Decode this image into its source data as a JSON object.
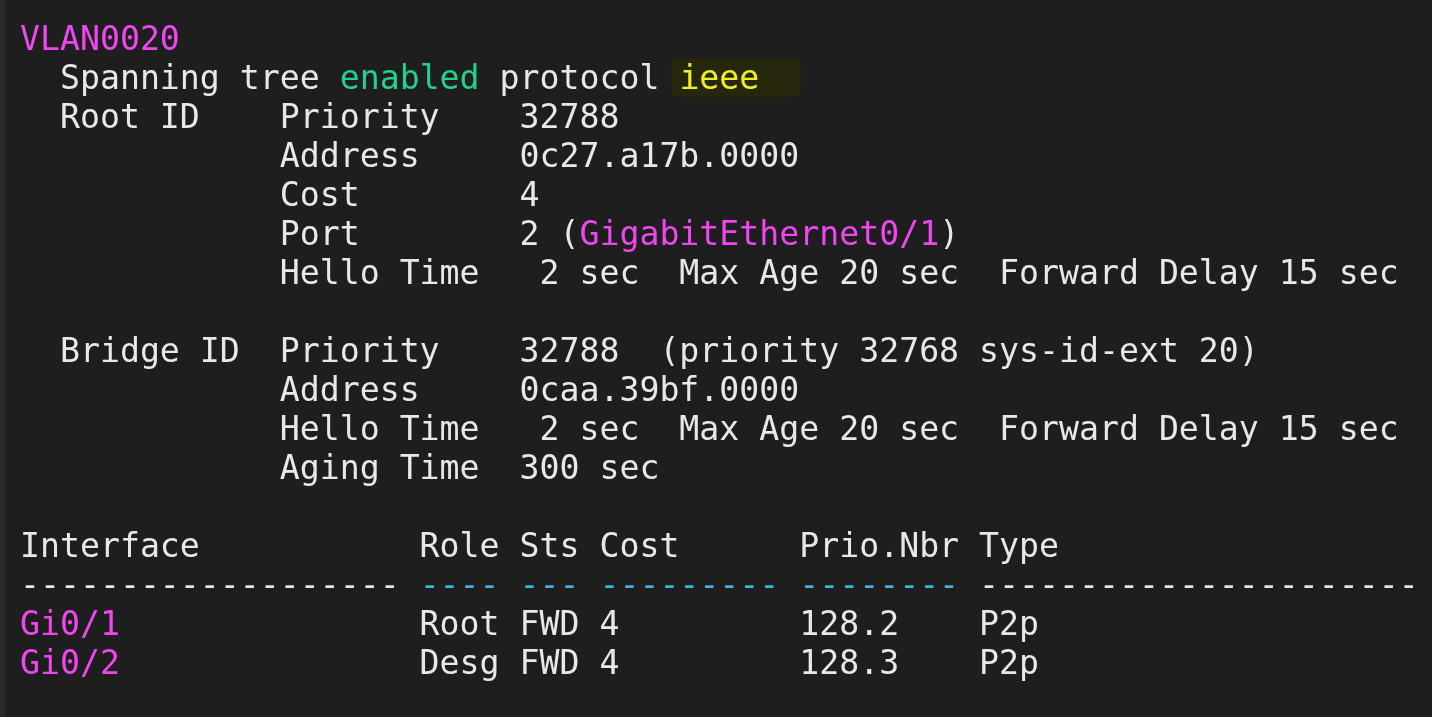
{
  "terminal": {
    "lines": [
      {
        "kind": "text",
        "segments": [
          {
            "text": "VLAN0020",
            "color": "#f046f0"
          }
        ]
      },
      {
        "kind": "text",
        "segments": [
          {
            "text": "  Spanning tree "
          },
          {
            "text": "enabled",
            "color": "#23d18b"
          },
          {
            "text": " protocol "
          },
          {
            "text": "ieee",
            "color": "#f0f020",
            "highlighted": true
          }
        ]
      },
      {
        "kind": "text",
        "segments": [
          {
            "text": "  Root ID    Priority    32788"
          }
        ]
      },
      {
        "kind": "text",
        "segments": [
          {
            "text": "             Address     0c27.a17b.0000"
          }
        ]
      },
      {
        "kind": "text",
        "segments": [
          {
            "text": "             Cost        4"
          }
        ]
      },
      {
        "kind": "text",
        "segments": [
          {
            "text": "             Port        2 ("
          },
          {
            "text": "GigabitEthernet0/1",
            "color": "#f046f0"
          },
          {
            "text": ")"
          }
        ]
      },
      {
        "kind": "text",
        "segments": [
          {
            "text": "             Hello Time   2 sec  Max Age 20 sec  Forward Delay 15 sec"
          }
        ]
      },
      {
        "kind": "blank"
      },
      {
        "kind": "text",
        "segments": [
          {
            "text": "  Bridge ID  Priority    32788  (priority 32768 sys-id-ext 20)"
          }
        ]
      },
      {
        "kind": "text",
        "segments": [
          {
            "text": "             Address     0caa.39bf.0000"
          }
        ]
      },
      {
        "kind": "text",
        "segments": [
          {
            "text": "             Hello Time   2 sec  Max Age 20 sec  Forward Delay 15 sec"
          }
        ]
      },
      {
        "kind": "text",
        "segments": [
          {
            "text": "             Aging Time  300 sec"
          }
        ]
      },
      {
        "kind": "blank"
      },
      {
        "kind": "text",
        "segments": [
          {
            "text": "Interface           Role Sts Cost      Prio.Nbr Type"
          }
        ]
      },
      {
        "kind": "text",
        "segments": [
          {
            "text": "------------------- "
          },
          {
            "text": "---- --- --------- --------",
            "color": "#3bb8d8"
          },
          {
            "text": " ----------------------"
          }
        ]
      },
      {
        "kind": "text",
        "segments": [
          {
            "text": "Gi0/1",
            "color": "#f046f0"
          },
          {
            "text": "               Root FWD 4         128.2    P2p"
          }
        ]
      },
      {
        "kind": "text",
        "segments": [
          {
            "text": "Gi0/2",
            "color": "#f046f0"
          },
          {
            "text": "               Desg FWD 4         128.3    P2p"
          }
        ]
      }
    ]
  }
}
